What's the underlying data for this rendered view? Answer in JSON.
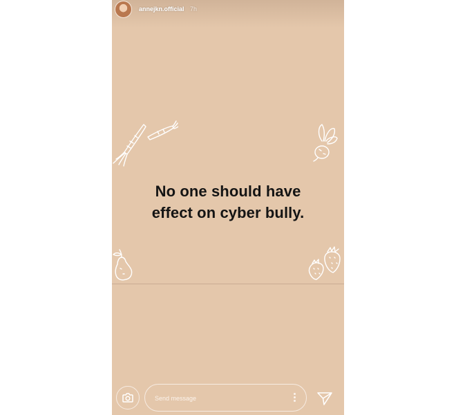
{
  "story": {
    "username": "annejkn.official",
    "time": "7h",
    "text_line1": "No one should have",
    "text_line2": "effect on cyber bully."
  },
  "footer": {
    "message_placeholder": "Send message"
  },
  "colors": {
    "background": "#e4c7ab",
    "text": "#141414",
    "doodle": "#ffffff"
  },
  "icons": {
    "avatar": "avatar",
    "camera": "camera-icon",
    "more": "more-vertical-icon",
    "send": "send-icon"
  }
}
